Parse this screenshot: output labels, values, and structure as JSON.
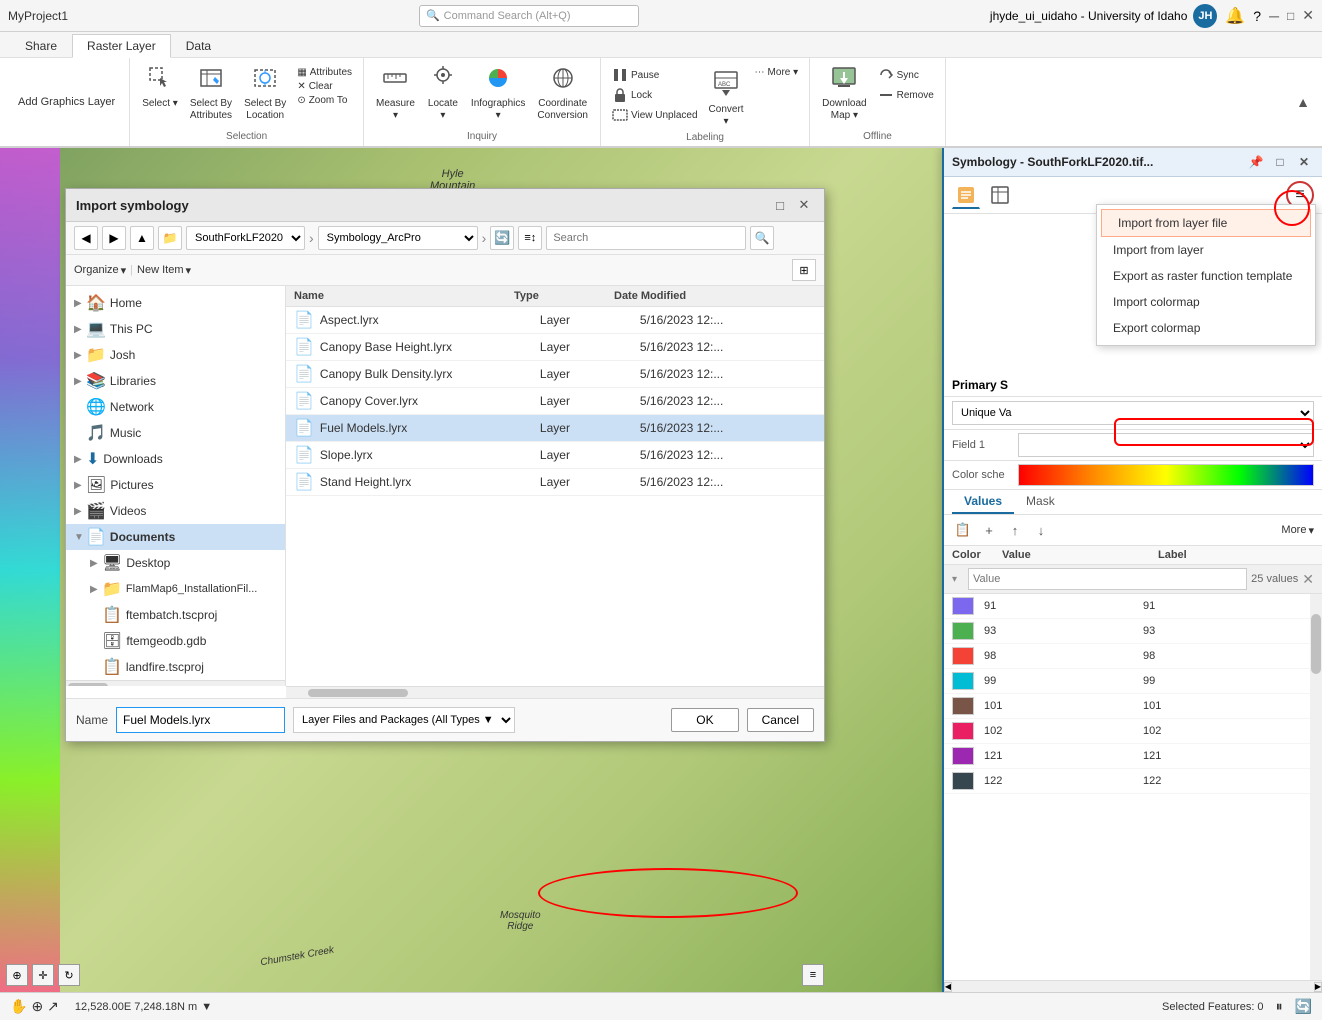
{
  "titlebar": {
    "project": "MyProject1",
    "search_placeholder": "Command Search (Alt+Q)",
    "user": "jhyde_ui_uidaho - University of Idaho",
    "user_initials": "JH",
    "min_btn": "─",
    "max_btn": "□",
    "close_btn": "✕"
  },
  "ribbon_tabs": [
    "Share",
    "Raster Layer",
    "Data"
  ],
  "ribbon": {
    "groups": [
      {
        "name": "add-graphics",
        "label": "Add Graphics Layer",
        "items": []
      },
      {
        "name": "selection",
        "label": "Selection",
        "items": [
          {
            "id": "select",
            "icon": "⬚",
            "label": "Select"
          },
          {
            "id": "select-by-attributes",
            "icon": "⬚",
            "label": "Select By\nAttributes"
          },
          {
            "id": "select-by-location",
            "icon": "⬚",
            "label": "Select By\nLocation"
          }
        ],
        "small_items": [
          {
            "id": "attributes",
            "icon": "▦",
            "label": "Attributes"
          },
          {
            "id": "clear",
            "icon": "✕",
            "label": "Clear"
          },
          {
            "id": "zoom-to",
            "icon": "⊙",
            "label": "Zoom To"
          }
        ]
      },
      {
        "name": "inquiry",
        "label": "Inquiry",
        "items": [
          {
            "id": "measure",
            "icon": "📏",
            "label": "Measure"
          },
          {
            "id": "locate",
            "icon": "🔭",
            "label": "Locate"
          },
          {
            "id": "infographics",
            "icon": "📊",
            "label": "Infographics"
          },
          {
            "id": "coordinate-conversion",
            "icon": "🌐",
            "label": "Coordinate\nConversion"
          }
        ]
      },
      {
        "name": "labeling",
        "label": "Labeling",
        "items": [
          {
            "id": "pause",
            "icon": "⏸",
            "label": "Pause"
          },
          {
            "id": "lock",
            "icon": "🔒",
            "label": "Lock"
          },
          {
            "id": "view-unplaced",
            "icon": "◻",
            "label": "View Unplaced"
          },
          {
            "id": "convert",
            "icon": "🔄",
            "label": "Convert"
          },
          {
            "id": "more-labeling",
            "icon": "⋯",
            "label": "More"
          }
        ]
      },
      {
        "name": "offline",
        "label": "Offline",
        "items": [
          {
            "id": "download-map",
            "icon": "⬇",
            "label": "Download\nMap"
          },
          {
            "id": "sync",
            "icon": "🔄",
            "label": "Sync"
          },
          {
            "id": "remove",
            "icon": "✕",
            "label": "Remove"
          }
        ]
      }
    ]
  },
  "dialog": {
    "title": "Import symbology",
    "nav": {
      "back": "◀",
      "forward": "▶",
      "up": "▲"
    },
    "breadcrumb": {
      "path1": "SouthForkLF2020",
      "path2": "Symbology_ArcPro"
    },
    "toolbar": {
      "organize_label": "Organize",
      "new_item_label": "New Item"
    },
    "sidebar_items": [
      {
        "id": "home",
        "icon": "🏠",
        "label": "Home",
        "expanded": false
      },
      {
        "id": "this-pc",
        "icon": "💻",
        "label": "This PC",
        "expanded": false
      },
      {
        "id": "josh",
        "icon": "📁",
        "label": "Josh",
        "expanded": false
      },
      {
        "id": "libraries",
        "icon": "📚",
        "label": "Libraries",
        "expanded": false
      },
      {
        "id": "network",
        "icon": "🌐",
        "label": "Network",
        "expanded": false
      },
      {
        "id": "music",
        "icon": "🎵",
        "label": "Music",
        "expanded": false
      },
      {
        "id": "downloads",
        "icon": "⬇",
        "label": "Downloads",
        "expanded": false
      },
      {
        "id": "pictures",
        "icon": "🖼",
        "label": "Pictures",
        "expanded": false
      },
      {
        "id": "videos",
        "icon": "🎬",
        "label": "Videos",
        "expanded": false
      },
      {
        "id": "documents",
        "icon": "📄",
        "label": "Documents",
        "selected": true,
        "expanded": true
      },
      {
        "id": "desktop",
        "icon": "🖥",
        "label": "Desktop",
        "expanded": false
      },
      {
        "id": "flammap6",
        "icon": "📁",
        "label": "FlamMap6_InstallationFil...",
        "expanded": false
      },
      {
        "id": "ftembatch",
        "icon": "📋",
        "label": "ftembatch.tscproj",
        "expanded": false
      },
      {
        "id": "ftemgeodb",
        "icon": "🗄",
        "label": "ftemgeodb.gdb",
        "expanded": false
      },
      {
        "id": "landfire",
        "icon": "📋",
        "label": "landfire.tscproj",
        "expanded": false
      }
    ],
    "files_columns": [
      "Name",
      "Type",
      "Date Modified"
    ],
    "files": [
      {
        "id": "aspect",
        "name": "Aspect.lyrx",
        "type": "Layer",
        "date": "5/16/2023 12:...",
        "selected": false
      },
      {
        "id": "canopy-base",
        "name": "Canopy Base Height.lyrx",
        "type": "Layer",
        "date": "5/16/2023 12:...",
        "selected": false
      },
      {
        "id": "canopy-bulk",
        "name": "Canopy Bulk Density.lyrx",
        "type": "Layer",
        "date": "5/16/2023 12:...",
        "selected": false
      },
      {
        "id": "canopy-cover",
        "name": "Canopy Cover.lyrx",
        "type": "Layer",
        "date": "5/16/2023 12:...",
        "selected": false
      },
      {
        "id": "fuel-models",
        "name": "Fuel Models.lyrx",
        "type": "Layer",
        "date": "5/16/2023 12:...",
        "selected": true
      },
      {
        "id": "slope",
        "name": "Slope.lyrx",
        "type": "Layer",
        "date": "5/16/2023 12:...",
        "selected": false
      },
      {
        "id": "stand-height",
        "name": "Stand Height.lyrx",
        "type": "Layer",
        "date": "5/16/2023 12:...",
        "selected": false
      }
    ],
    "footer": {
      "name_label": "Name",
      "name_value": "Fuel Models.lyrx",
      "file_type": "Layer Files and Packages (All Types ▼",
      "ok_label": "OK",
      "cancel_label": "Cancel"
    }
  },
  "symbology": {
    "title": "Symbology - SouthForkLF2020.tif...",
    "tabs": [
      {
        "id": "values",
        "label": "Values",
        "active": true
      },
      {
        "id": "mask",
        "label": "Mask"
      }
    ],
    "primary_label": "Primary S",
    "renderer_type": "Unique Va",
    "field1_label": "Field 1",
    "color_scheme_label": "Color sche",
    "values_toolbar_items": [
      {
        "id": "copy",
        "icon": "📋"
      },
      {
        "id": "add",
        "icon": "+"
      },
      {
        "id": "up",
        "icon": "↑"
      },
      {
        "id": "down",
        "icon": "↓"
      },
      {
        "id": "more",
        "label": "More",
        "icon": "▼"
      }
    ],
    "values_columns": [
      "Color",
      "Value",
      "Label"
    ],
    "value_filter": "Value",
    "value_count": "25 values",
    "values": [
      {
        "color": "#7B68EE",
        "value": "91",
        "label": "91"
      },
      {
        "color": "#4CAF50",
        "value": "93",
        "label": "93"
      },
      {
        "color": "#F44336",
        "value": "98",
        "label": "98"
      },
      {
        "color": "#00BCD4",
        "value": "99",
        "label": "99"
      },
      {
        "color": "#795548",
        "value": "101",
        "label": "101"
      },
      {
        "color": "#E91E63",
        "value": "102",
        "label": "102"
      },
      {
        "color": "#9C27B0",
        "value": "121",
        "label": "121"
      },
      {
        "color": "#37474F",
        "value": "122",
        "label": "122"
      }
    ]
  },
  "dropdown_menu": {
    "items": [
      {
        "id": "import-from-layer-file",
        "label": "Import from layer file",
        "highlighted": true
      },
      {
        "id": "import-from-layer",
        "label": "Import from layer"
      },
      {
        "id": "export-as-raster",
        "label": "Export as raster function template"
      },
      {
        "id": "import-colormap",
        "label": "Import colormap"
      },
      {
        "id": "export-colormap",
        "label": "Export colormap"
      }
    ]
  },
  "statusbar": {
    "coordinates": "12,528.00E 7,248.18N m",
    "dropdown_icon": "▼",
    "selected_features": "Selected Features: 0",
    "pause_icon": "⏸",
    "refresh_icon": "🔄"
  },
  "map": {
    "label1": "Hyle\nMountain",
    "label2": "Mosquito\nRidge",
    "label3": "Chumstek Creek"
  }
}
